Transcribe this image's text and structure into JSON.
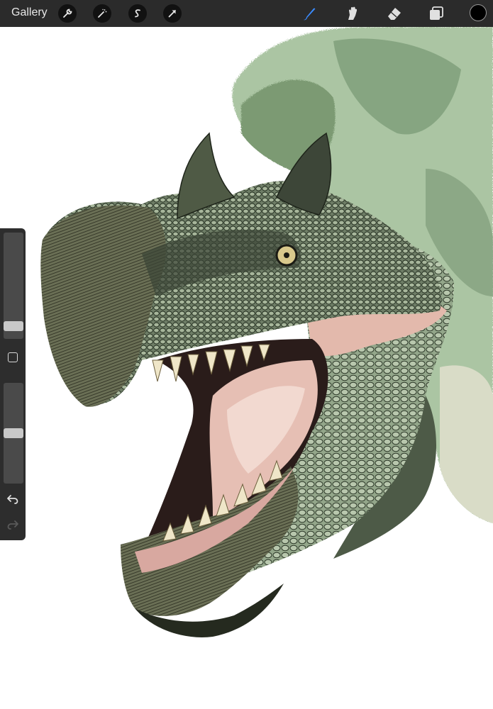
{
  "toolbar": {
    "gallery_label": "Gallery",
    "left_tools": [
      "wrench-icon",
      "magic-wand-icon",
      "selection-s-icon",
      "transform-arrow-icon"
    ],
    "right_tools": [
      "brush-icon",
      "smudge-icon",
      "eraser-icon",
      "layers-icon"
    ],
    "active_tool": "brush",
    "active_color": "#000000",
    "accent_color": "#3a8bff"
  },
  "sidebar": {
    "brush_size_level": 0.08,
    "opacity_level": 0.5,
    "buttons": [
      "modify-square-icon",
      "undo-icon",
      "redo-icon"
    ]
  },
  "canvas": {
    "content": "dinosaur-head-illustration"
  }
}
